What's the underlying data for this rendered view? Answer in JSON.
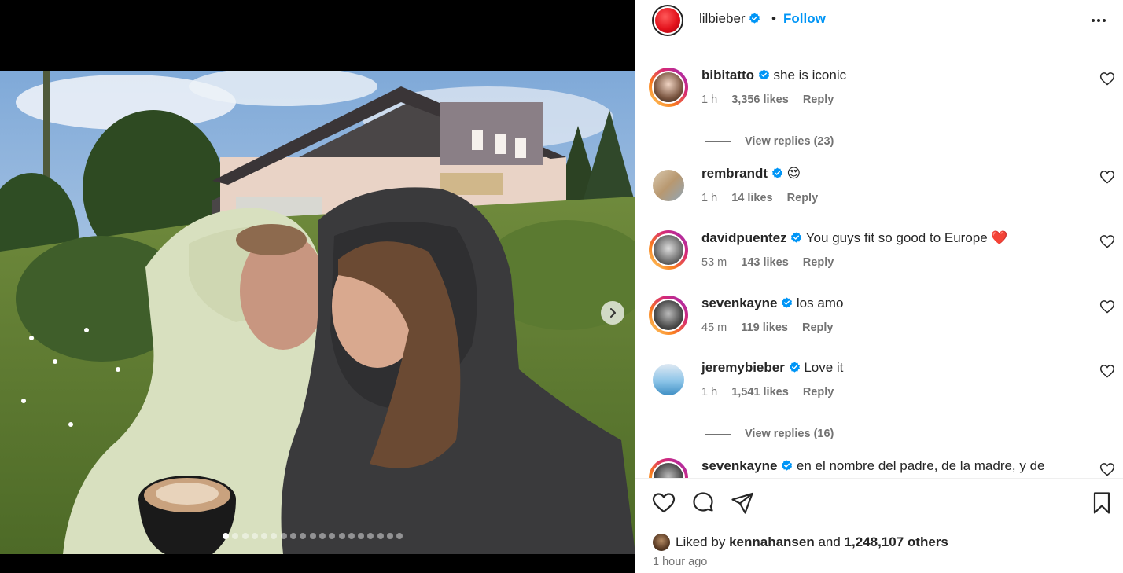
{
  "post": {
    "username": "lilbieber",
    "separator": "•",
    "follow_label": "Follow",
    "more_icon": "more-horizontal-icon"
  },
  "carousel": {
    "slide_count": 19,
    "active_index": 0
  },
  "comments": [
    {
      "username": "bibitatto",
      "text": "she is iconic",
      "time": "1 h",
      "likes": "3,356 likes",
      "reply": "Reply",
      "view_replies": "View replies (23)"
    },
    {
      "username": "rembrandt",
      "text": "😍",
      "time": "1 h",
      "likes": "14 likes",
      "reply": "Reply"
    },
    {
      "username": "davidpuentez",
      "text": "You guys fit so good to Europe ❤️",
      "time": "53 m",
      "likes": "143 likes",
      "reply": "Reply"
    },
    {
      "username": "sevenkayne",
      "text": "los amo",
      "time": "45 m",
      "likes": "119 likes",
      "reply": "Reply"
    },
    {
      "username": "jeremybieber",
      "text": "Love it",
      "time": "1 h",
      "likes": "1,541 likes",
      "reply": "Reply",
      "view_replies": "View replies (16)"
    },
    {
      "username": "sevenkayne",
      "text": "en el nombre del padre, de la madre, y de"
    }
  ],
  "likes_summary": {
    "prefix": "Liked by",
    "liker": "kennahansen",
    "joiner": "and",
    "others": "1,248,107 others"
  },
  "timestamp": "1 hour ago",
  "colors": {
    "link_blue": "#0095f6",
    "verified_blue": "#0095f6",
    "muted_text": "#737373"
  }
}
